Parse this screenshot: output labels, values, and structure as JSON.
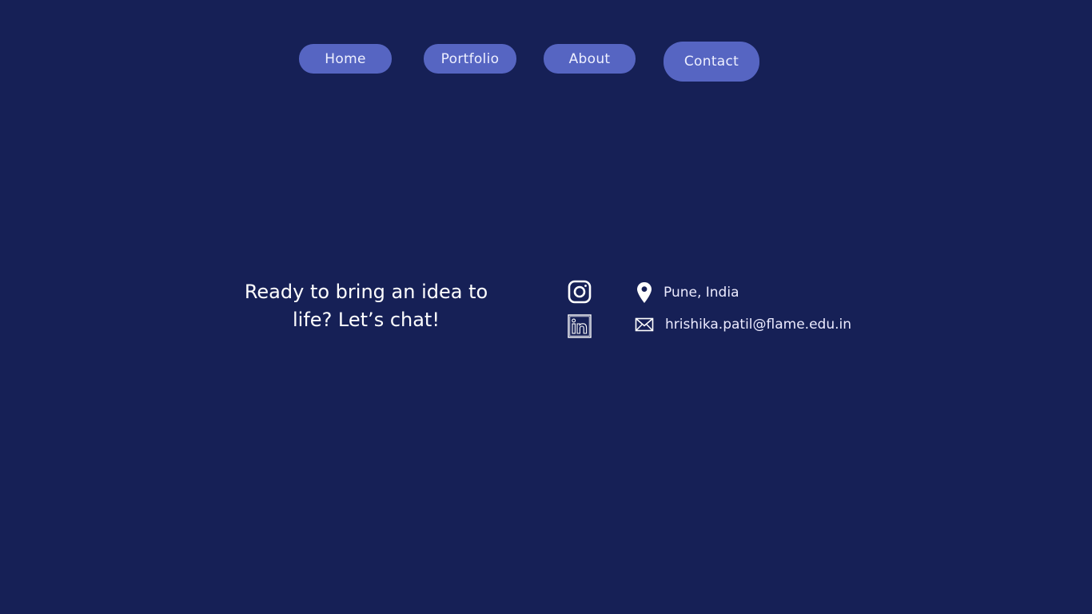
{
  "nav": {
    "home": "Home",
    "portfolio": "Portfolio",
    "about": "About",
    "contact": "Contact"
  },
  "main": {
    "tagline_line1": "Ready to bring an idea to",
    "tagline_line2": "life? Let’s chat!"
  },
  "social": {
    "instagram_icon": "instagram-icon",
    "linkedin_icon": "linkedin-icon"
  },
  "contact": {
    "location": "Pune, India",
    "email": "hrishika.patil@flame.edu.in",
    "location_icon": "map-pin-icon",
    "email_icon": "envelope-icon"
  },
  "colors": {
    "background": "#162056",
    "button": "#5665c2",
    "text": "#ffffff"
  }
}
